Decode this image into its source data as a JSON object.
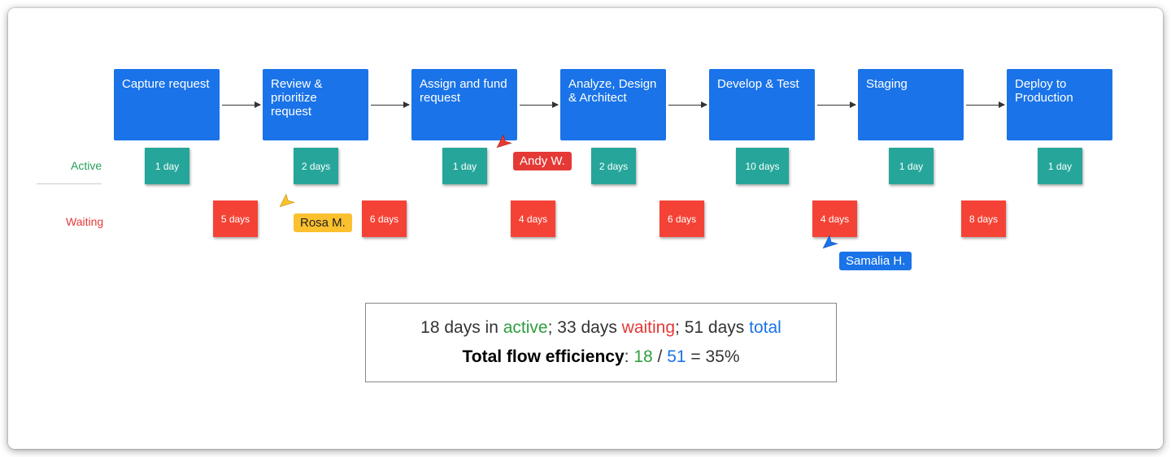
{
  "labels": {
    "active": "Active",
    "waiting": "Waiting"
  },
  "stages": [
    {
      "name": "Capture request",
      "active": "1 day",
      "waiting": "5 days"
    },
    {
      "name": "Review & prioritize request",
      "active": "2 days",
      "waiting": "6 days"
    },
    {
      "name": "Assign and fund request",
      "active": "1 day",
      "waiting": "4 days"
    },
    {
      "name": "Analyze, Design & Architect",
      "active": "2 days",
      "waiting": "6 days"
    },
    {
      "name": "Develop & Test",
      "active": "10 days",
      "waiting": "4 days"
    },
    {
      "name": "Staging",
      "active": "1 day",
      "waiting": "8 days"
    },
    {
      "name": "Deploy to Production",
      "active": "1 day",
      "waiting": null
    }
  ],
  "cursors": {
    "rosa": {
      "name": "Rosa M.",
      "color": "#fbc02d",
      "text_color": "#222"
    },
    "andy": {
      "name": "Andy W.",
      "color": "#e53935",
      "text_color": "#fff"
    },
    "samalia": {
      "name": "Samalia H.",
      "color": "#1a73e8",
      "text_color": "#fff"
    }
  },
  "summary": {
    "active_days": "18",
    "days_in_text": " days in ",
    "active_word": "active",
    "sep1": "; ",
    "waiting_days": "33",
    "days_text": " days ",
    "waiting_word": "waiting",
    "sep2": "; ",
    "total_days": "51",
    "days_text2": " days ",
    "total_word": "total",
    "efficiency_label": "Total flow efficiency",
    "colon": ": ",
    "num": "18",
    "slash": " / ",
    "den": "51",
    "equals": " = 35%"
  },
  "colors": {
    "stage_bg": "#1a73e8",
    "active_bg": "#26a69a",
    "waiting_bg": "#f44336"
  }
}
